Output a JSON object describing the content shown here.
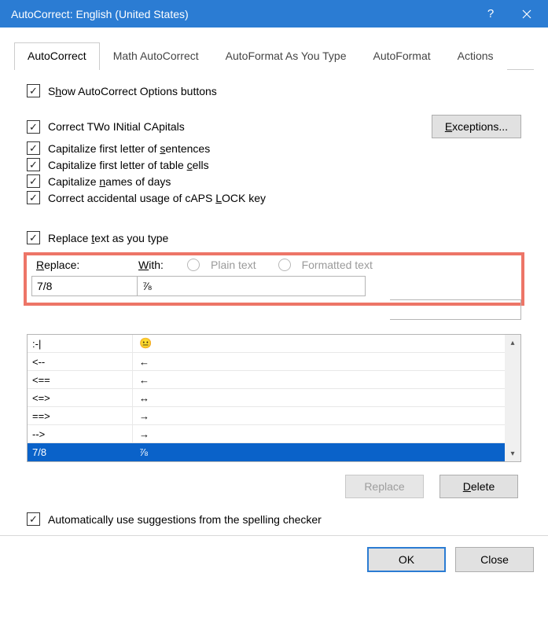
{
  "title": "AutoCorrect: English (United States)",
  "tabs": {
    "autocorrect": "AutoCorrect",
    "math": "Math AutoCorrect",
    "asyoutype": "AutoFormat As You Type",
    "autoformat": "AutoFormat",
    "actions": "Actions"
  },
  "opts": {
    "show_buttons_pre": "S",
    "show_buttons_u": "h",
    "show_buttons_post": "ow AutoCorrect Options buttons",
    "two_caps_pre": "Correct TWo INitial CApitals",
    "first_sent_pre": "Capitalize first letter of ",
    "first_sent_u": "s",
    "first_sent_post": "entences",
    "table_cells_pre": "Capitalize first letter of table ",
    "table_cells_u": "c",
    "table_cells_post": "ells",
    "names_days_pre": "Capitalize ",
    "names_days_u": "n",
    "names_days_post": "ames of days",
    "caps_lock_pre": "Correct accidental usage of cAPS ",
    "caps_lock_u": "L",
    "caps_lock_post": "OCK key",
    "replace_as_type_pre": "Replace ",
    "replace_as_type_u": "t",
    "replace_as_type_post": "ext as you type",
    "auto_suggest": "Automatically use suggestions from the spelling checker"
  },
  "exceptions_u": "E",
  "exceptions_post": "xceptions...",
  "replace_label_u": "R",
  "replace_label_post": "eplace:",
  "with_label_u": "W",
  "with_label_post": "ith:",
  "radio_plain": "Plain text",
  "radio_formatted": "Formatted text",
  "replace_value": "7/8",
  "with_value": "⅞",
  "list": [
    {
      "r": ":-|",
      "w": "😐"
    },
    {
      "r": "<--",
      "w": "←"
    },
    {
      "r": "<==",
      "w": "←"
    },
    {
      "r": "<=>",
      "w": "↔"
    },
    {
      "r": "==>",
      "w": "→"
    },
    {
      "r": "-->",
      "w": "→"
    },
    {
      "r": "7/8",
      "w": "⅞"
    }
  ],
  "btn_replace": "Replace",
  "btn_delete_u": "D",
  "btn_delete_post": "elete",
  "btn_ok": "OK",
  "btn_close": "Close"
}
